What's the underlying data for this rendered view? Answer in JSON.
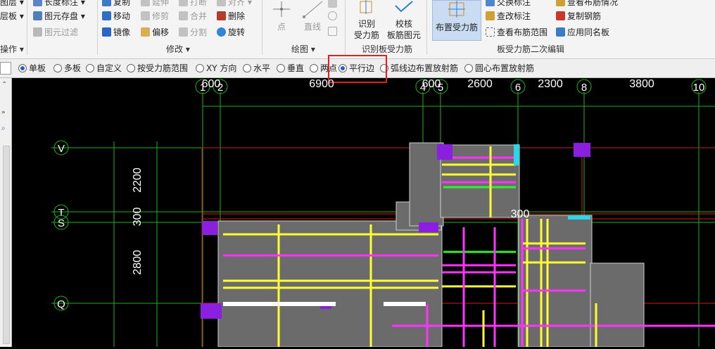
{
  "ribbon": {
    "col1": [
      "图层",
      "层板"
    ],
    "col1_group": "操作",
    "col2": [
      {
        "label": "长度标注",
        "icon": "dimension-icon",
        "disabled": false
      },
      {
        "label": "图元存盘",
        "icon": "save-element-icon",
        "disabled": false
      },
      {
        "label": "图元过滤",
        "icon": "filter-icon",
        "disabled": true
      }
    ],
    "modify": {
      "items": [
        {
          "label": "复制",
          "icon": "copy-icon",
          "disabled": false
        },
        {
          "label": "移动",
          "icon": "move-icon",
          "disabled": false
        },
        {
          "label": "镜像",
          "icon": "mirror-icon",
          "disabled": false
        },
        {
          "label": "延伸",
          "icon": "extend-icon",
          "disabled": true
        },
        {
          "label": "修剪",
          "icon": "trim-icon",
          "disabled": true
        },
        {
          "label": "偏移",
          "icon": "offset-icon",
          "disabled": false
        },
        {
          "label": "打断",
          "icon": "break-icon",
          "disabled": true
        },
        {
          "label": "合并",
          "icon": "merge-icon",
          "disabled": true
        },
        {
          "label": "分割",
          "icon": "split-icon",
          "disabled": true
        },
        {
          "label": "对齐",
          "icon": "align-icon",
          "disabled": true
        },
        {
          "label": "删除",
          "icon": "delete-icon",
          "disabled": false
        },
        {
          "label": "旋转",
          "icon": "rotate-icon",
          "disabled": false
        }
      ],
      "group": "修改"
    },
    "draw": {
      "point": "点",
      "line": "直线",
      "group": "绘图"
    },
    "identify": {
      "identify_label": "识别\n受力筋",
      "check_label": "校核\n板筋图元",
      "group": "识别板受力筋"
    },
    "edit": {
      "place": "布置受力筋",
      "items": [
        "交换标注",
        "查改标注",
        "查看布筋范围",
        "查看布筋情况",
        "复制钢筋",
        "应用同名板"
      ],
      "group": "板受力筋二次编辑"
    }
  },
  "options": [
    {
      "label": "单板",
      "checked": true
    },
    {
      "label": "多板",
      "checked": false
    },
    {
      "label": "自定义",
      "checked": false
    },
    {
      "label": "按受力筋范围",
      "checked": false
    },
    {
      "label": "XY 方向",
      "checked": false
    },
    {
      "label": "水平",
      "checked": false
    },
    {
      "label": "垂直",
      "checked": false
    },
    {
      "label": "两点",
      "checked": false
    },
    {
      "label": "平行边",
      "checked": true
    },
    {
      "label": "弧线边布置放射筋",
      "checked": false
    },
    {
      "label": "圆心布置放射筋",
      "checked": false
    }
  ],
  "canvas": {
    "axes_top": [
      "1",
      "2",
      "4",
      "5",
      "6",
      "8",
      "10"
    ],
    "dims_top": [
      "600",
      "6900",
      "600",
      "2600",
      "2300",
      "3800"
    ],
    "axes_left": [
      "V",
      "T",
      "S",
      "Q"
    ],
    "dims_left": [
      "2200",
      "300",
      "2800"
    ],
    "dim_inner": "300",
    "colors": {
      "bg": "#000000",
      "grid": "#1db31d",
      "axis_red": "#d21a1a",
      "slab": "#6b6b6b",
      "rebar_y": "#ffff33",
      "rebar_m": "#ff33ff",
      "rebar_g": "#33ee33",
      "corner": "#8a1fe0",
      "cyan": "#2cd6e6",
      "dim_text": "#ffffff"
    }
  }
}
